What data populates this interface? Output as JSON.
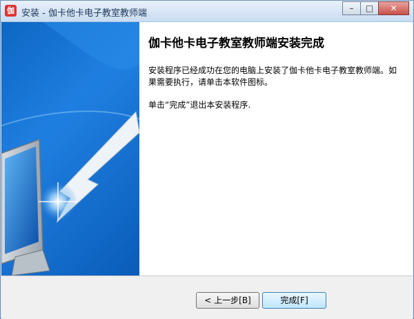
{
  "window": {
    "title": "安装 - 伽卡他卡电子教室教师端",
    "icon_glyph": "伽",
    "minimize_icon": "minimize-icon",
    "maximize_icon": "maximize-icon",
    "close_icon": "close-icon"
  },
  "main": {
    "heading": "伽卡他卡电子教室教师端安装完成",
    "description": "安装程序已经成功在您的电脑上安装了伽卡他卡电子教室教师端。如果需要执行，请单击本软件图标。",
    "finish_note": "单击“完成”退出本安装程序."
  },
  "buttons": {
    "back": "< 上一步[B]",
    "finish": "完成[F]"
  },
  "colors": {
    "side_panel": "#1f7fe0",
    "title_bar": "#c9dcf1",
    "close_button": "#c9504a"
  }
}
